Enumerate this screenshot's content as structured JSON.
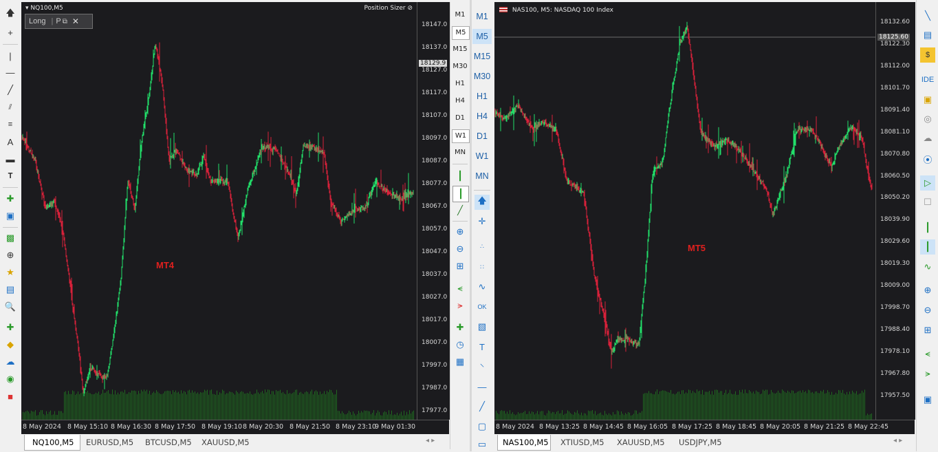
{
  "mt4": {
    "chart_label": "NQ100,M5",
    "plugin_title": "Position Sizer",
    "widget_long": "Long",
    "widget_p": "P",
    "watermark": "MT4",
    "current_price": "18129.9",
    "price_labels": [
      "18147.0",
      "18137.0",
      "18129.9",
      "18127.0",
      "18117.0",
      "18107.0",
      "18097.0",
      "18087.0",
      "18077.0",
      "18067.0",
      "18057.0",
      "18047.0",
      "18037.0",
      "18027.0",
      "18017.0",
      "18007.0",
      "17997.0",
      "17987.0",
      "17977.0"
    ],
    "time_labels": [
      "8 May 2024",
      "8 May 15:10",
      "8 May 16:30",
      "8 May 17:50",
      "8 May 19:10",
      "8 May 20:30",
      "8 May 21:50",
      "8 May 23:10",
      "9 May 01:30"
    ],
    "timeframes": [
      "M1",
      "M5",
      "M15",
      "M30",
      "H1",
      "H4",
      "D1",
      "W1",
      "MN"
    ],
    "active_timeframe": "M5",
    "tabs": [
      "NQ100,M5",
      "EURUSD,M5",
      "BTCUSD,M5",
      "XAUUSD,M5"
    ]
  },
  "mt5": {
    "chart_label": "NAS100, M5:  NASDAQ 100 Index",
    "watermark": "MT5",
    "current_price": "18125.60",
    "price_labels": [
      "18132.60",
      "18125.60",
      "18122.30",
      "18112.00",
      "18101.70",
      "18091.40",
      "18081.10",
      "18070.80",
      "18060.50",
      "18050.20",
      "18039.90",
      "18029.60",
      "18019.30",
      "18009.00",
      "17998.70",
      "17988.40",
      "17978.10",
      "17967.80",
      "17957.50"
    ],
    "time_labels": [
      "8 May 2024",
      "8 May 13:25",
      "8 May 14:45",
      "8 May 16:05",
      "8 May 17:25",
      "8 May 18:45",
      "8 May 20:05",
      "8 May 21:25",
      "8 May 22:45"
    ],
    "timeframes": [
      "M1",
      "M5",
      "M15",
      "M30",
      "H1",
      "H4",
      "D1",
      "W1",
      "MN"
    ],
    "active_timeframe": "M5",
    "tabs": [
      "NAS100,M5",
      "XTIUSD,M5",
      "XAUUSD,M5",
      "USDJPY,M5"
    ],
    "side_label_ide": "IDE"
  },
  "colors": {
    "bull": "#22e06a",
    "bear": "#d8213a",
    "volume": "#1f6b1f",
    "watermark": "#e0201e",
    "chart_bg": "#1b1b1e"
  },
  "icons": [
    "cursor-icon",
    "crosshair-icon",
    "vertical-line-icon",
    "horizontal-line-icon",
    "trendline-icon",
    "fibonacci-icon",
    "text-icon",
    "label-icon",
    "zoom-in-icon",
    "zoom-out-icon",
    "settings-icon"
  ]
}
